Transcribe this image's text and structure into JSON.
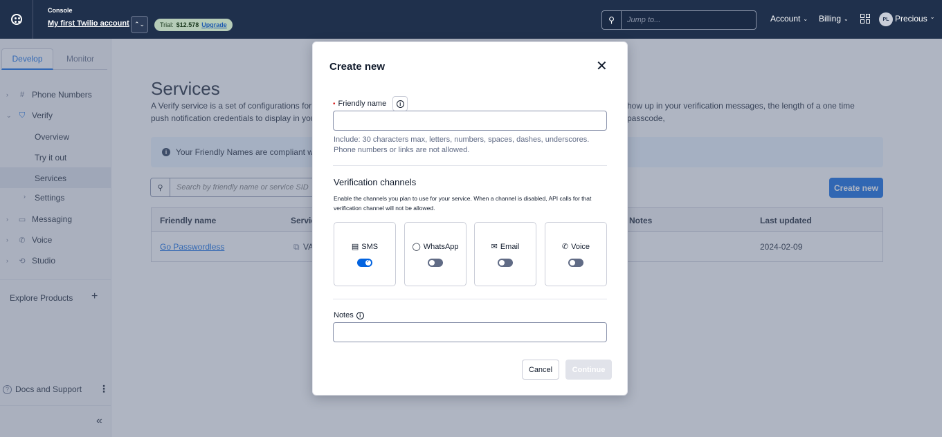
{
  "topbar": {
    "console_label": "Console",
    "account_name": "My first Twilio account",
    "trial_label": "Trial:",
    "trial_amount": "$12.578",
    "upgrade_label": "Upgrade",
    "jump_placeholder": "Jump to...",
    "account_menu": "Account",
    "billing_menu": "Billing",
    "user_initials": "PL",
    "user_name": "Precious"
  },
  "sidebar": {
    "tabs": [
      {
        "label": "Develop",
        "active": true
      },
      {
        "label": "Monitor",
        "active": false
      }
    ],
    "items": [
      {
        "label": "Phone Numbers",
        "icon": "hash-icon"
      },
      {
        "label": "Verify",
        "icon": "verify-shield-icon",
        "expanded": true
      },
      {
        "label": "Messaging",
        "icon": "chat-icon"
      },
      {
        "label": "Voice",
        "icon": "phone-icon"
      },
      {
        "label": "Studio",
        "icon": "studio-icon"
      }
    ],
    "verify_children": [
      {
        "label": "Overview"
      },
      {
        "label": "Try it out"
      },
      {
        "label": "Services",
        "active": true
      },
      {
        "label": "Settings"
      }
    ],
    "explore_label": "Explore Products",
    "docs_label": "Docs and Support"
  },
  "main": {
    "title": "Services",
    "description": "A Verify service is a set of configurations for ma",
    "description_line2": "push notification credentials to display in your v",
    "description_right": "how up in your verification messages, the length of a one time passcode,",
    "banner_text": "Your Friendly Names are compliant with",
    "search_placeholder": "Search by friendly name or service SID",
    "create_new_label": "Create new",
    "table": {
      "headers": [
        "Friendly name",
        "Servic",
        "Notes",
        "Last updated"
      ],
      "rows": [
        {
          "friendly_name": "Go Passwordless",
          "service": "VA",
          "notes": "",
          "last_updated": "2024-02-09"
        }
      ]
    }
  },
  "modal": {
    "title": "Create new",
    "required_mark": "•",
    "friendly_name_label": "Friendly name",
    "friendly_name_value": "",
    "friendly_name_help": "Include: 30 characters max, letters, numbers, spaces, dashes, underscores. Phone numbers or links are not allowed.",
    "channels_title": "Verification channels",
    "channels_desc": "Enable the channels you plan to use for your service. When a channel is disabled, API calls for that verification channel will not be allowed.",
    "channels": [
      {
        "label": "SMS",
        "icon": "sms-icon",
        "enabled": true
      },
      {
        "label": "WhatsApp",
        "icon": "whatsapp-icon",
        "enabled": false
      },
      {
        "label": "Email",
        "icon": "email-icon",
        "enabled": false
      },
      {
        "label": "Voice",
        "icon": "phone-icon",
        "enabled": false
      }
    ],
    "notes_label": "Notes",
    "notes_value": "",
    "cancel_label": "Cancel",
    "continue_label": "Continue"
  },
  "colors": {
    "topbar_bg": "#1f304c",
    "accent": "#0263e0",
    "overlay": "rgba(96,107,133,0.5)"
  }
}
